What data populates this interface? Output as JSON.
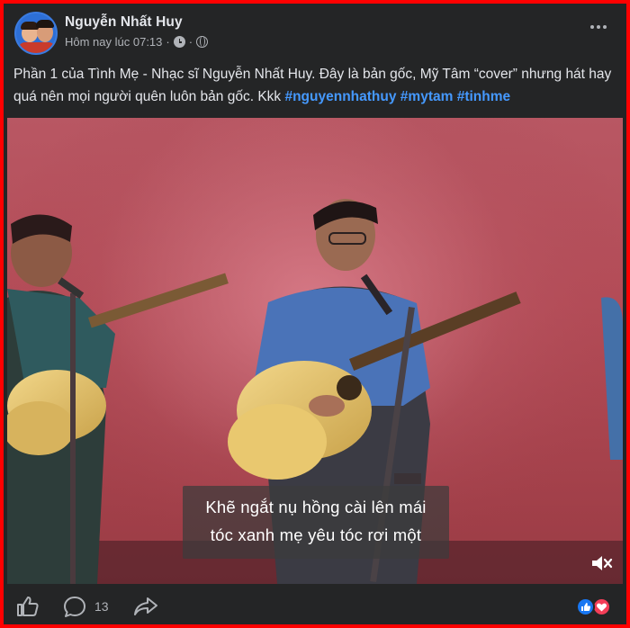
{
  "post": {
    "author": "Nguyễn Nhất Huy",
    "timestamp": "Hôm nay lúc 07:13",
    "separator": "·",
    "caption_text": "Phần 1 của Tình Mẹ - Nhạc sĩ Nguyễn Nhất Huy. Đây là bản gốc, Mỹ Tâm “cover” nhưng hát hay quá nên mọi người quên luôn bản gốc. Kkk ",
    "hashtags": [
      "#nguyennhathuy",
      "#mytam",
      "#tinhme"
    ]
  },
  "video": {
    "subtitle_line1": "Khẽ ngắt nụ hồng cài lên mái",
    "subtitle_line2": "tóc xanh mẹ yêu tóc rơi một"
  },
  "footer": {
    "comment_count": "13"
  },
  "colors": {
    "frame_border": "#ff0000",
    "background": "#242526",
    "hashtag": "#4599ff",
    "like_reaction": "#1877f2",
    "love_reaction": "#f33e58"
  },
  "icons": [
    "clock-icon",
    "globe-icon",
    "more-icon",
    "mute-icon",
    "like-icon",
    "comment-icon",
    "share-icon",
    "like-reaction-icon",
    "love-reaction-icon"
  ]
}
